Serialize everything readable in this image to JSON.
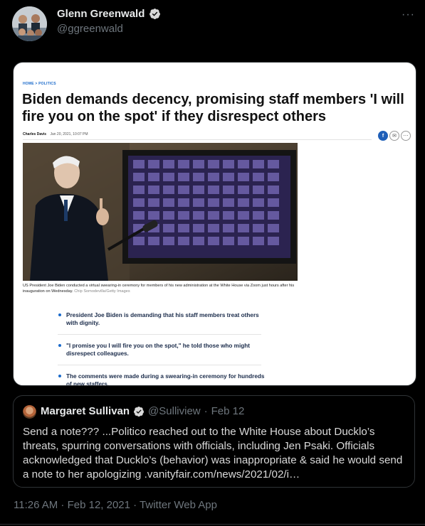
{
  "author": {
    "name": "Glenn Greenwald",
    "handle": "@ggreenwald"
  },
  "menu": {
    "more_label": "···"
  },
  "article": {
    "breadcrumb": "HOME > POLITICS",
    "headline": "Biden demands decency, promising staff members 'I will fire you on the spot' if they disrespect others",
    "byline_author": "Charles Davis",
    "byline_date": "Jan 20, 2021, 10:07 PM",
    "caption": "US President Joe Biden conducted a virtual swearing-in ceremony for members of his new administration at the White House via Zoom just hours after his inauguration on Wednesday.",
    "credit": "Chip Somodevilla/Getty Images",
    "bullets": [
      "President Joe Biden is demanding that his staff members treat others with dignity.",
      "\"I promise you I will fire you on the spot,\" he told those who might disrespect colleagues.",
      "The comments were made during a swearing-in ceremony for hundreds of new staffers."
    ]
  },
  "quoted": {
    "name": "Margaret Sullivan",
    "handle": "@Sulliview",
    "separator": "·",
    "date": "Feb 12",
    "text": "Send a note??? ...Politico reached out to the White House about Ducklo’s threats, spurring conversations with officials, including Jen Psaki. Officials acknowledged that Ducklo’s (behavior) was inappropriate & said he would send a note to her apologizing .vanityfair.com/news/2021/02/i…"
  },
  "footer": {
    "timestamp": "11:26 AM · Feb 12, 2021 · Twitter Web App"
  },
  "colors": {
    "background": "#000000",
    "verified": "#d9d9d9",
    "muted": "#6e767d",
    "link_blue": "#1a6acb"
  }
}
